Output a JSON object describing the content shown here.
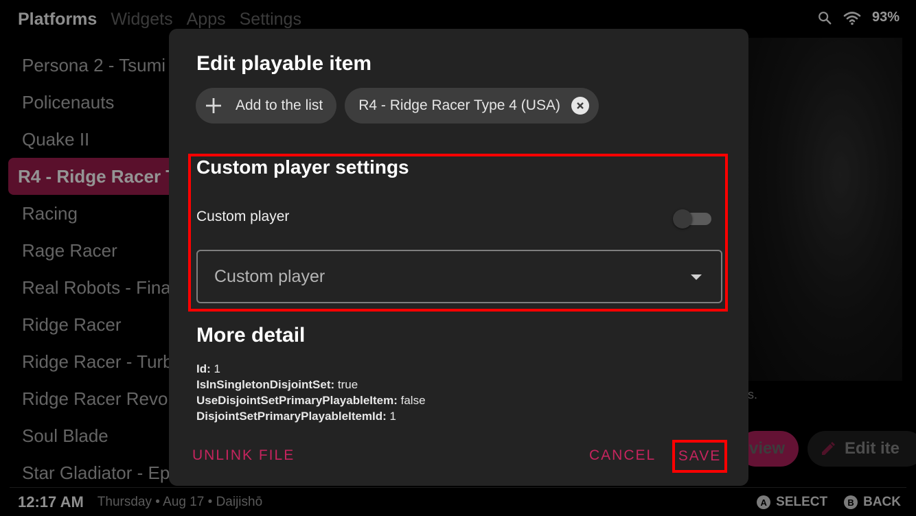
{
  "topbar": {
    "tabs": [
      {
        "label": "Platforms",
        "active": true
      },
      {
        "label": "Widgets",
        "active": false
      },
      {
        "label": "Apps",
        "active": false
      },
      {
        "label": "Settings",
        "active": false
      }
    ],
    "battery": "93%"
  },
  "gamelist": {
    "items": [
      {
        "label": "Persona 2 - Tsumi",
        "selected": false
      },
      {
        "label": "Policenauts",
        "selected": false
      },
      {
        "label": "Quake II",
        "selected": false
      },
      {
        "label": "R4 - Ridge Racer T",
        "selected": true
      },
      {
        "label": "Racing",
        "selected": false
      },
      {
        "label": "Rage Racer",
        "selected": false
      },
      {
        "label": "Real Robots - Fina",
        "selected": false
      },
      {
        "label": "Ridge Racer",
        "selected": false
      },
      {
        "label": "Ridge Racer - Turb",
        "selected": false
      },
      {
        "label": "Ridge Racer Revol",
        "selected": false
      },
      {
        "label": "Soul Blade",
        "selected": false
      },
      {
        "label": "Star Gladiator - Ep",
        "selected": false
      }
    ]
  },
  "background": {
    "trailing_text": "s.",
    "view_label": "view",
    "edit_label": "Edit ite"
  },
  "bottombar": {
    "time": "12:17 AM",
    "date": "Thursday • Aug 17 • Daijishō",
    "hint_a_key": "A",
    "hint_a_label": "SELECT",
    "hint_b_key": "B",
    "hint_b_label": "BACK"
  },
  "dialog": {
    "title": "Edit playable item",
    "add_chip_label": "Add to the list",
    "item_chip_label": "R4 - Ridge Racer Type 4 (USA)",
    "custom_section": {
      "title": "Custom player settings",
      "toggle_label": "Custom player",
      "toggle_on": false,
      "select_placeholder": "Custom player"
    },
    "more_detail": {
      "title": "More detail",
      "fields": [
        {
          "key": "Id:",
          "value": " 1"
        },
        {
          "key": "IsInSingletonDisjointSet:",
          "value": " true"
        },
        {
          "key": "UseDisjointSetPrimaryPlayableItem:",
          "value": " false"
        },
        {
          "key": "DisjointSetPrimaryPlayableItemId:",
          "value": " 1"
        }
      ]
    },
    "buttons": {
      "unlink": "UNLINK FILE",
      "cancel": "CANCEL",
      "save": "SAVE"
    }
  },
  "colors": {
    "accent": "#c6245e",
    "selected_bg": "#8b1a44",
    "highlight": "#ff0000"
  }
}
